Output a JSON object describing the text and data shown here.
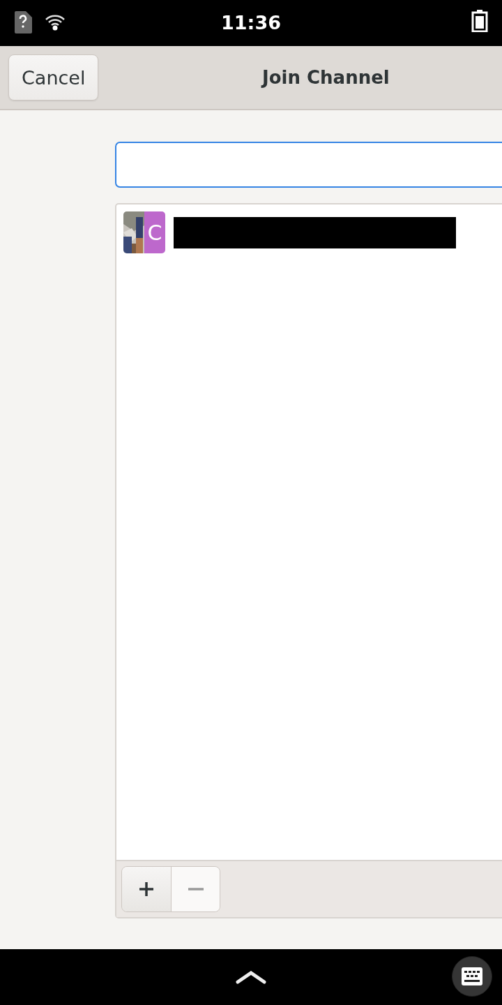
{
  "status_bar": {
    "time": "11:36"
  },
  "header": {
    "cancel": "Cancel",
    "title": "Join Channel"
  },
  "entry": {
    "focused": true
  },
  "accounts": [
    {
      "initial": "C",
      "color": "#bd68cc",
      "redacted": true
    }
  ],
  "toolbar": {
    "add_disabled": false,
    "remove_disabled": true
  }
}
